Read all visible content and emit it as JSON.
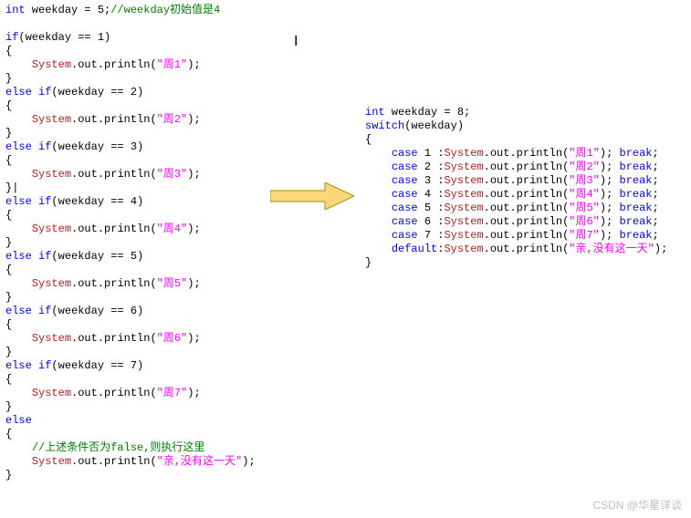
{
  "left": {
    "l1": {
      "kw": "int",
      "rest": " weekday = 5;",
      "cmt": "//weekday初始值是4"
    },
    "if1": {
      "kw": "if",
      "cond": "(weekday == 1)"
    },
    "brace_open": "{",
    "p1": {
      "sys": "System",
      "rest": ".out.println(",
      "str": "\"周1\"",
      "end": ");"
    },
    "brace_close": "}",
    "elif2": {
      "kw1": "else",
      "kw2": "if",
      "cond": "(weekday == 2)"
    },
    "p2": {
      "sys": "System",
      "rest": ".out.println(",
      "str": "\"周2\"",
      "end": ");"
    },
    "close2": "}|",
    "elif3": {
      "kw1": "else",
      "kw2": "if",
      "cond": "(weekday == 3)"
    },
    "p3": {
      "sys": "System",
      "rest": ".out.println(",
      "str": "\"周3\"",
      "end": ");"
    },
    "close3": "}|",
    "elif4": {
      "kw1": "else",
      "kw2": "if",
      "cond": "(weekday == 4)"
    },
    "p4": {
      "sys": "System",
      "rest": ".out.println(",
      "str": "\"周4\"",
      "end": ");"
    },
    "elif5": {
      "kw1": "else",
      "kw2": "if",
      "cond": "(weekday == 5)"
    },
    "p5": {
      "sys": "System",
      "rest": ".out.println(",
      "str": "\"周5\"",
      "end": ");"
    },
    "elif6": {
      "kw1": "else",
      "kw2": "if",
      "cond": "(weekday == 6)"
    },
    "p6": {
      "sys": "System",
      "rest": ".out.println(",
      "str": "\"周6\"",
      "end": ");"
    },
    "elif7": {
      "kw1": "else",
      "kw2": "if",
      "cond": "(weekday == 7)"
    },
    "p7": {
      "sys": "System",
      "rest": ".out.println(",
      "str": "\"周7\"",
      "end": ");"
    },
    "else": {
      "kw": "else"
    },
    "cmt_last": "//上述条件否为false,则执行这里",
    "pd": {
      "sys": "System",
      "rest": ".out.println(",
      "str": "\"亲,没有这一天\"",
      "end": ");"
    }
  },
  "right": {
    "l1": {
      "kw": "int",
      "rest": " weekday = 8;"
    },
    "sw": {
      "kw": "switch",
      "rest": "(weekday)"
    },
    "brace_open": "{",
    "c1": {
      "kw": "case",
      "num": " 1 :",
      "sys": "System",
      "rest": ".out.println(",
      "str": "\"周1\"",
      "end": "); ",
      "brk": "break",
      "semi": ";"
    },
    "c2": {
      "kw": "case",
      "num": " 2 :",
      "sys": "System",
      "rest": ".out.println(",
      "str": "\"周2\"",
      "end": "); ",
      "brk": "break",
      "semi": ";"
    },
    "c3": {
      "kw": "case",
      "num": " 3 :",
      "sys": "System",
      "rest": ".out.println(",
      "str": "\"周3\"",
      "end": "); ",
      "brk": "break",
      "semi": ";"
    },
    "c4": {
      "kw": "case",
      "num": " 4 :",
      "sys": "System",
      "rest": ".out.println(",
      "str": "\"周4\"",
      "end": "); ",
      "brk": "break",
      "semi": ";"
    },
    "c5": {
      "kw": "case",
      "num": " 5 :",
      "sys": "System",
      "rest": ".out.println(",
      "str": "\"周5\"",
      "end": "); ",
      "brk": "break",
      "semi": ";"
    },
    "c6": {
      "kw": "case",
      "num": " 6 :",
      "sys": "System",
      "rest": ".out.println(",
      "str": "\"周6\"",
      "end": "); ",
      "brk": "break",
      "semi": ";"
    },
    "c7": {
      "kw": "case",
      "num": " 7 :",
      "sys": "System",
      "rest": ".out.println(",
      "str": "\"周7\"",
      "end": "); ",
      "brk": "break",
      "semi": ";"
    },
    "df": {
      "kw": "default",
      "colon": ":",
      "sys": "System",
      "rest": ".out.println(",
      "str": "\"亲,没有这一天\"",
      "end": ");"
    },
    "brace_close": "}"
  },
  "cursor": "I",
  "watermark": "CSDN @华星详谈",
  "arrow": {
    "fill": "#f7d77a",
    "stroke": "#b58b00"
  }
}
